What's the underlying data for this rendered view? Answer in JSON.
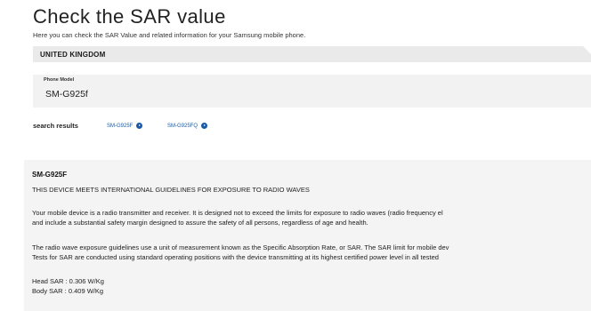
{
  "header": {
    "title": "Check the SAR value",
    "subtitle": "Here you can check the SAR Value and related information for your Samsung mobile phone."
  },
  "country_selector": {
    "selected": "UNITED KINGDOM"
  },
  "model_field": {
    "label": "Phone Model",
    "value": "SM-G925f"
  },
  "search_results": {
    "label": "search results",
    "links": [
      "SM-G925F",
      "SM-G925FQ"
    ]
  },
  "device_info": {
    "model": "SM-G925F",
    "heading": "THIS DEVICE MEETS INTERNATIONAL GUIDELINES FOR EXPOSURE TO RADIO WAVES",
    "paragraph1_line1": "Your mobile device is a radio transmitter and receiver. It is designed not to exceed the limits for exposure to radio waves (radio frequency el",
    "paragraph1_line2": "and include a substantial safety margin designed to assure the safety of all persons, regardless of age and health.",
    "paragraph2_line1": "The radio wave exposure guidelines use a unit of measurement known as the Specific Absorption Rate, or SAR. The SAR limit for mobile dev",
    "paragraph2_line2": "Tests for SAR are conducted using standard operating positions with the device transmitting at its highest certified power level in all tested",
    "head_sar": "Head SAR : 0.306 W/Kg",
    "body_sar": "Body SAR : 0.409 W/Kg"
  }
}
